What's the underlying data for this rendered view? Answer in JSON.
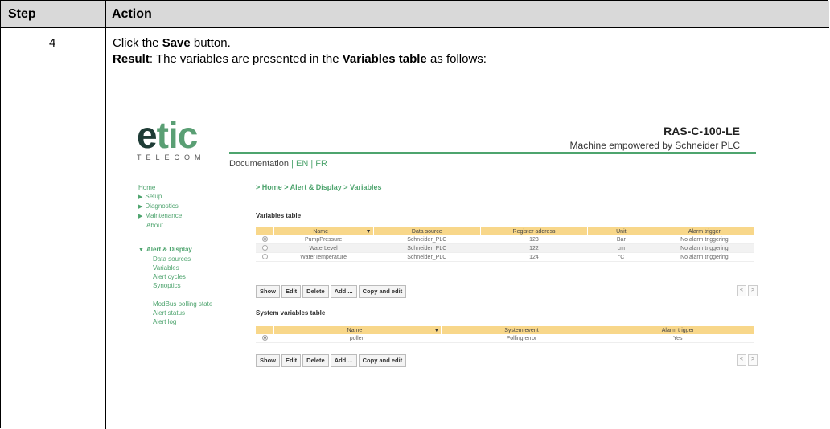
{
  "table": {
    "header_step": "Step",
    "header_action": "Action",
    "step_number": "4",
    "line1": {
      "prefix": "Click the ",
      "bold": "Save",
      "suffix": " button."
    },
    "line2": {
      "bold1": "Result",
      "mid": ": The variables are presented in the ",
      "bold2": "Variables table",
      "suffix": " as follows:"
    }
  },
  "screenshot": {
    "logo": {
      "part1": "e",
      "part2": "tic",
      "sub": "TELECOM"
    },
    "product_name": "RAS-C-100-LE",
    "product_tagline": "Machine empowered by Schneider PLC",
    "docbar": {
      "doc": "Documentation",
      "sep1": " | ",
      "en": "EN",
      "sep2": " | ",
      "fr": "FR"
    },
    "nav": {
      "home": "Home",
      "setup": "Setup",
      "diagnostics": "Diagnostics",
      "maintenance": "Maintenance",
      "about": "About",
      "alert_display": "Alert & Display",
      "data_sources": "Data sources",
      "variables": "Variables",
      "alert_cycles": "Alert cycles",
      "synoptics": "Synoptics",
      "modbus_polling": "ModBus polling state",
      "alert_status": "Alert status",
      "alert_log": "Alert log"
    },
    "breadcrumb": "> Home > Alert & Display > Variables",
    "variables_table": {
      "title": "Variables table",
      "columns": [
        "Name",
        "Data source",
        "Register address",
        "Unit",
        "Alarm trigger"
      ],
      "sort_icon": "▼",
      "rows": [
        {
          "selected": true,
          "name": "PumpPressure",
          "source": "Schneider_PLC",
          "register": "123",
          "unit": "Bar",
          "alarm": "No alarm triggering"
        },
        {
          "selected": false,
          "name": "WaterLevel",
          "source": "Schneider_PLC",
          "register": "122",
          "unit": "cm",
          "alarm": "No alarm triggering"
        },
        {
          "selected": false,
          "name": "WaterTemperature",
          "source": "Schneider_PLC",
          "register": "124",
          "unit": "°C",
          "alarm": "No alarm triggering"
        }
      ]
    },
    "system_table": {
      "title": "System variables table",
      "columns": [
        "Name",
        "System event",
        "Alarm trigger"
      ],
      "sort_icon": "▼",
      "rows": [
        {
          "selected": true,
          "name": "pollerr",
          "event": "Polling error",
          "alarm": "Yes"
        }
      ]
    },
    "buttons": {
      "show": "Show",
      "edit": "Edit",
      "delete": "Delete",
      "add": "Add ...",
      "copy_edit": "Copy and edit"
    },
    "pager": {
      "prev": "<",
      "next": ">"
    },
    "colors": {
      "accent": "#4ea46e",
      "table_header": "#f8d78a",
      "logo_dark": "#1f3c36"
    }
  }
}
